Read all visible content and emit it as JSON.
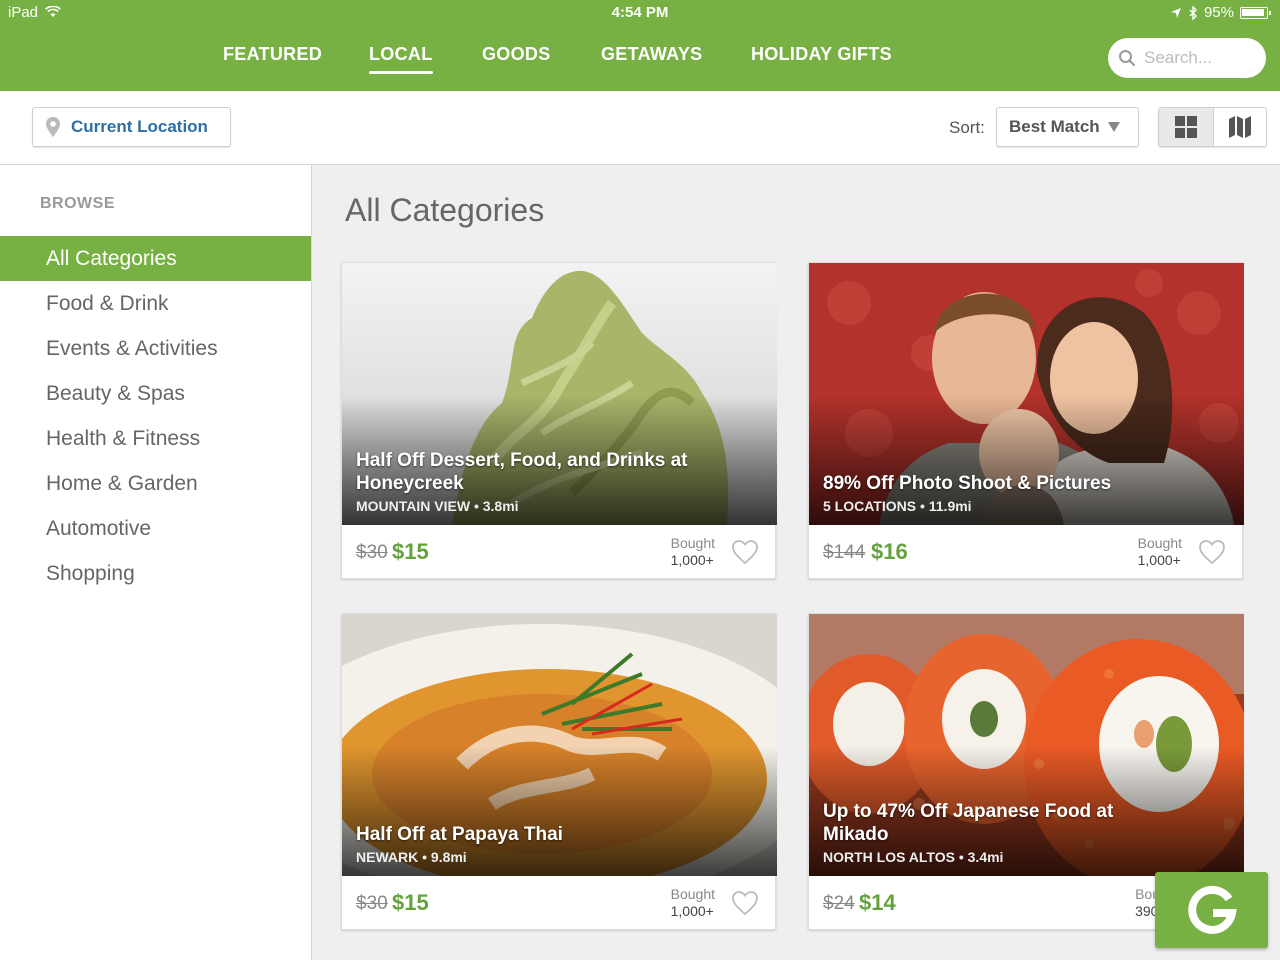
{
  "status_bar": {
    "device": "iPad",
    "time": "4:54 PM",
    "battery": "95%"
  },
  "nav": {
    "tabs": [
      {
        "label": "FEATURED"
      },
      {
        "label": "LOCAL",
        "active": true
      },
      {
        "label": "GOODS"
      },
      {
        "label": "GETAWAYS"
      },
      {
        "label": "HOLIDAY GIFTS"
      }
    ],
    "search_placeholder": "Search..."
  },
  "toolbar": {
    "location_label": "Current Location",
    "sort_label": "Sort:",
    "sort_value": "Best Match"
  },
  "sidebar": {
    "heading": "BROWSE",
    "items": [
      {
        "label": "All Categories",
        "active": true
      },
      {
        "label": "Food & Drink"
      },
      {
        "label": "Events & Activities"
      },
      {
        "label": "Beauty & Spas"
      },
      {
        "label": "Health & Fitness"
      },
      {
        "label": "Home & Garden"
      },
      {
        "label": "Automotive"
      },
      {
        "label": "Shopping"
      }
    ]
  },
  "main": {
    "title": "All Categories",
    "deals": [
      {
        "title": "Half Off Dessert, Food, and Drinks at Honeycreek",
        "subtitle": "MOUNTAIN VIEW • 3.8mi",
        "old_price": "$30",
        "new_price": "$15",
        "bought_label": "Bought",
        "bought_count": "1,000+",
        "image": "green-dessert"
      },
      {
        "title": "89% Off Photo Shoot & Pictures",
        "subtitle": "5 LOCATIONS • 11.9mi",
        "old_price": "$144",
        "new_price": "$16",
        "bought_label": "Bought",
        "bought_count": "1,000+",
        "image": "family-portrait"
      },
      {
        "title": "Half Off at Papaya Thai",
        "subtitle": "NEWARK • 9.8mi",
        "old_price": "$30",
        "new_price": "$15",
        "bought_label": "Bought",
        "bought_count": "1,000+",
        "image": "thai-curry"
      },
      {
        "title": "Up to 47% Off Japanese Food at Mikado",
        "subtitle": "NORTH LOS ALTOS • 3.4mi",
        "old_price": "$24",
        "new_price": "$14",
        "bought_label": "Bou",
        "bought_count": "390",
        "image": "sushi-rolls"
      }
    ]
  },
  "fab": {
    "label": "G"
  },
  "colors": {
    "brand_green": "#78b143",
    "price_green": "#63a23d",
    "link_blue": "#2d6fa6"
  }
}
